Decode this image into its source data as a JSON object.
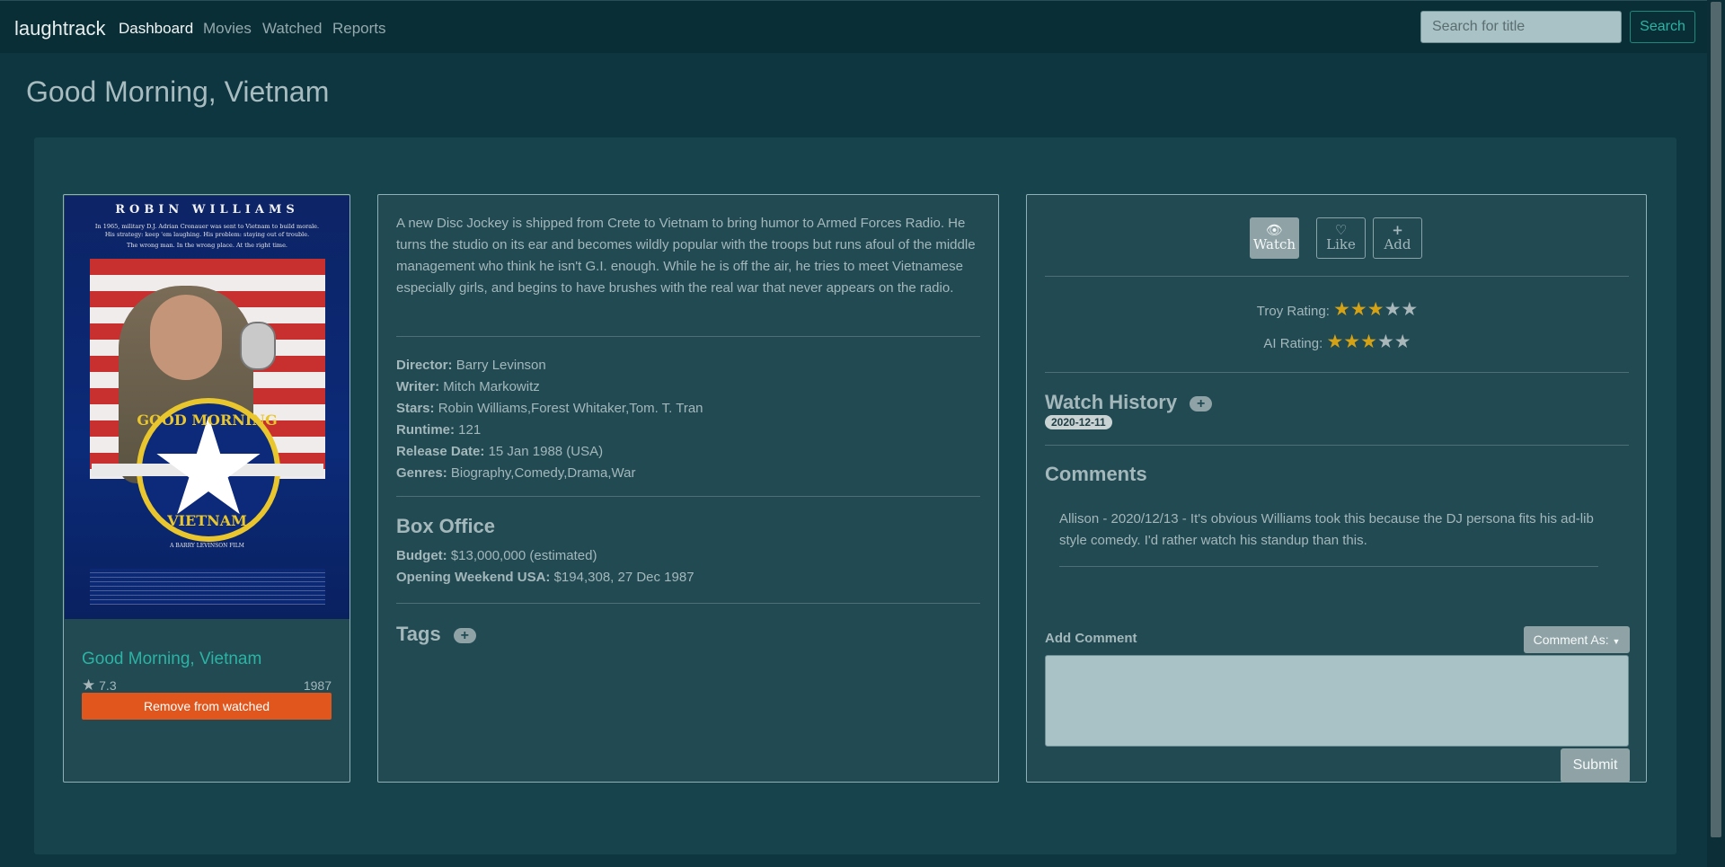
{
  "nav": {
    "brand": "laughtrack",
    "links": [
      "Dashboard",
      "Movies",
      "Watched",
      "Reports"
    ],
    "search_placeholder": "Search for title",
    "search_button": "Search"
  },
  "page_title": "Good Morning, Vietnam",
  "poster": {
    "actor": "ROBIN WILLIAMS",
    "tagline_1": "In 1965, military D.J. Adrian Cronauer was sent to Vietnam to build morale.",
    "tagline_2": "His strategy: keep 'em laughing. His problem: staying out of trouble.",
    "tagline_3": "The wrong man. In the wrong place. At the right time.",
    "logo_top": "GOOD MORNING",
    "logo_bottom": "VIETNAM",
    "credit": "A BARRY LEVINSON FILM"
  },
  "movie": {
    "title": "Good Morning, Vietnam",
    "rating": "7.3",
    "year": "1987",
    "remove_button": "Remove from watched"
  },
  "details": {
    "plot": "A new Disc Jockey is shipped from Crete to Vietnam to bring humor to Armed Forces Radio. He turns the studio on its ear and becomes wildly popular with the troops but runs afoul of the middle management who think he isn't G.I. enough. While he is off the air, he tries to meet Vietnamese especially girls, and begins to have brushes with the real war that never appears on the radio.",
    "director_label": "Director:",
    "director": "Barry Levinson",
    "writer_label": "Writer:",
    "writer": "Mitch Markowitz",
    "stars_label": "Stars:",
    "stars": "Robin Williams,Forest Whitaker,Tom. T. Tran",
    "runtime_label": "Runtime:",
    "runtime": "121",
    "release_label": "Release Date:",
    "release": "15 Jan 1988 (USA)",
    "genres_label": "Genres:",
    "genres": "Biography,Comedy,Drama,War",
    "box_office_heading": "Box Office",
    "budget_label": "Budget:",
    "budget": "$13,000,000 (estimated)",
    "opening_label": "Opening Weekend USA:",
    "opening": "$194,308, 27 Dec 1987",
    "tags_heading": "Tags"
  },
  "actions": {
    "watch": "Watch",
    "like": "Like",
    "add": "Add",
    "troy_label": "Troy Rating:",
    "troy_stars": 3,
    "ai_label": "AI Rating:",
    "ai_stars": 3,
    "watch_history_heading": "Watch History",
    "watch_dates": [
      "2020-12-11"
    ],
    "comments_heading": "Comments",
    "comment": "Allison - 2020/12/13 - It's obvious Williams took this because the DJ persona fits his ad-lib style comedy. I'd rather watch his standup than this.",
    "add_comment_label": "Add Comment",
    "comment_as_button": "Comment As:",
    "submit_button": "Submit"
  },
  "colors": {
    "accent": "#2bb3a3",
    "remove": "#e0561c",
    "star": "#d6a215"
  }
}
